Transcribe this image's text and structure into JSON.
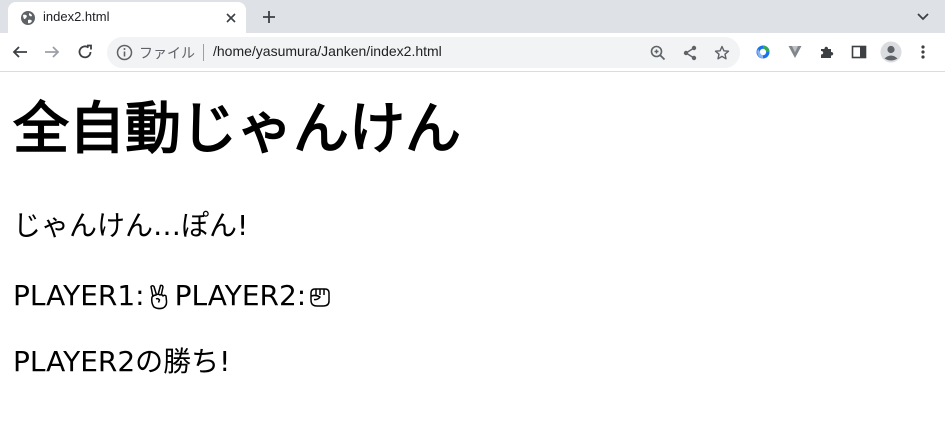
{
  "browser": {
    "tab": {
      "title": "index2.html",
      "favicon": "globe-icon"
    },
    "omnibox": {
      "chip_label": "ファイル",
      "url": "/home/yasumura/Janken/index2.html"
    }
  },
  "page": {
    "heading": "全自動じゃんけん",
    "call_text": "じゃんけん…ぽん!",
    "player1_label": "PLAYER1:",
    "player1_hand": "peace-hand-icon",
    "player2_label": "PLAYER2:",
    "player2_hand": "fist-hand-icon",
    "result": "PLAYER2の勝ち!"
  }
}
